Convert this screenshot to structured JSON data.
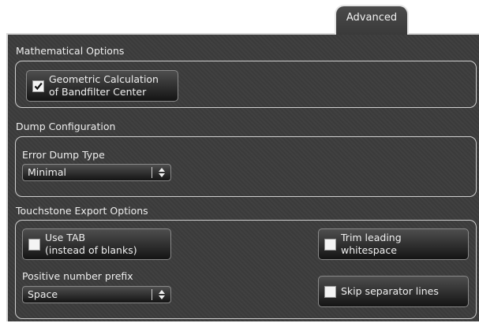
{
  "tabs": [
    {
      "label": "Advanced",
      "active": true
    }
  ],
  "sections": {
    "math": {
      "title": "Mathematical Options",
      "geometric": {
        "line1": "Geometric Calculation",
        "line2": "of Bandfilter Center",
        "checked": true
      }
    },
    "dump": {
      "title": "Dump Configuration",
      "error_dump_label": "Error Dump Type",
      "error_dump_value": "Minimal"
    },
    "touchstone": {
      "title": "Touchstone Export Options",
      "use_tab": {
        "line1": "Use TAB",
        "line2": "(instead of blanks)",
        "checked": false
      },
      "trim": {
        "line1": "Trim leading",
        "line2": "whitespace",
        "checked": false
      },
      "prefix_label": "Positive number prefix",
      "prefix_value": "Space",
      "skip": {
        "label": "Skip separator lines",
        "checked": false
      }
    }
  },
  "colors": {
    "panel_bg": "#3c3c3c",
    "border": "#cfcfcf",
    "text": "#eeeeee"
  }
}
